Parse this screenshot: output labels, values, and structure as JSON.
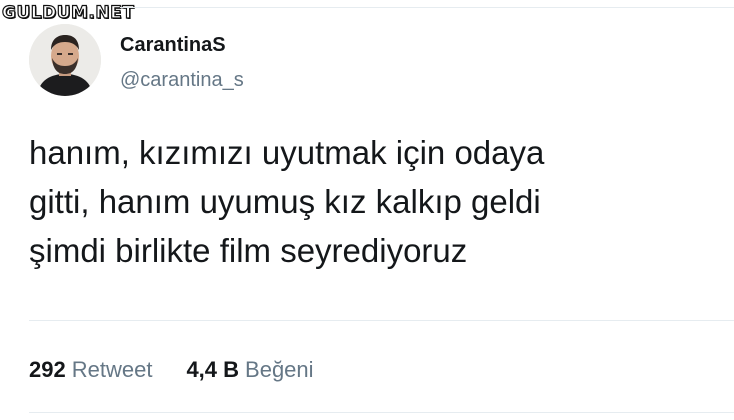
{
  "watermark": "GULDUM.NET",
  "author": {
    "display_name": "CarantinaS",
    "handle": "@carantina_s"
  },
  "tweet": {
    "lines": [
      "hanım, kızımızı uyutmak için odaya",
      "gitti, hanım uyumuş kız kalkıp geldi",
      "şimdi birlikte film seyrediyoruz"
    ]
  },
  "stats": {
    "retweets": {
      "count": "292",
      "label": "Retweet"
    },
    "likes": {
      "count": "4,4 B",
      "label": "Beğeni"
    }
  }
}
